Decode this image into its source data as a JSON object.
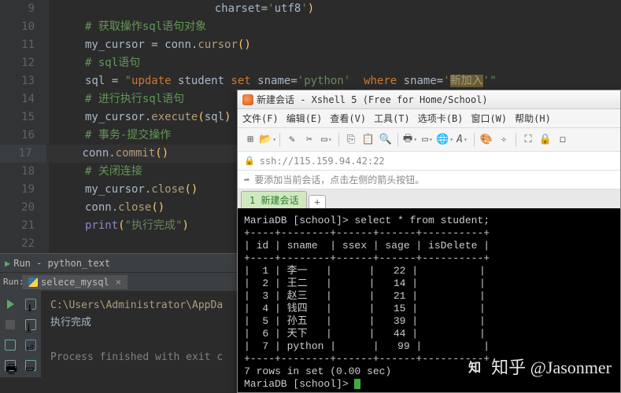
{
  "editor": {
    "lines": [
      {
        "n": "9",
        "type": "code_frag",
        "parts": [
          {
            "t": "                         charset=",
            "c": "c-var"
          },
          {
            "t": "'",
            "c": "c-str"
          },
          {
            "t": "utf8",
            "c": "c-var"
          },
          {
            "t": "'",
            "c": "c-str"
          },
          {
            "t": ")",
            "c": "c-paren"
          }
        ]
      },
      {
        "n": "10",
        "type": "comment",
        "text": "# 获取操作sql语句对象"
      },
      {
        "n": "11",
        "type": "code",
        "parts": [
          {
            "t": "my_cursor ",
            "c": "c-var"
          },
          {
            "t": "= ",
            "c": "c-op"
          },
          {
            "t": "conn",
            "c": "c-var"
          },
          {
            "t": ".",
            "c": "c-dot"
          },
          {
            "t": "cursor",
            "c": "c-fn"
          },
          {
            "t": "()",
            "c": "c-paren"
          }
        ]
      },
      {
        "n": "12",
        "type": "comment",
        "text": "# sql语句"
      },
      {
        "n": "13",
        "type": "code",
        "parts": [
          {
            "t": "sql ",
            "c": "c-var"
          },
          {
            "t": "= ",
            "c": "c-op"
          },
          {
            "t": "\"",
            "c": "c-str"
          },
          {
            "t": "update",
            "c": "sql-upd"
          },
          {
            "t": " student ",
            "c": "sql-col"
          },
          {
            "t": "set",
            "c": "sql-set"
          },
          {
            "t": " sname=",
            "c": "sql-col"
          },
          {
            "t": "'python'",
            "c": "sql-val"
          },
          {
            "t": "  ",
            "c": "sql-col"
          },
          {
            "t": "where",
            "c": "sql-where"
          },
          {
            "t": " sname=",
            "c": "sql-col"
          },
          {
            "t": "'",
            "c": "sql-val"
          },
          {
            "t": "新加入",
            "c": "sql-zh"
          },
          {
            "t": "'",
            "c": "sql-val"
          },
          {
            "t": "\"",
            "c": "c-str"
          }
        ]
      },
      {
        "n": "14",
        "type": "comment",
        "text": "# 进行执行sql语句"
      },
      {
        "n": "15",
        "type": "code",
        "parts": [
          {
            "t": "my_cursor",
            "c": "c-var"
          },
          {
            "t": ".",
            "c": "c-dot"
          },
          {
            "t": "execute",
            "c": "c-fn"
          },
          {
            "t": "(",
            "c": "c-paren"
          },
          {
            "t": "sql",
            "c": "c-var"
          },
          {
            "t": ")",
            "c": "c-paren"
          }
        ]
      },
      {
        "n": "16",
        "type": "comment",
        "text": "# 事务-提交操作"
      },
      {
        "n": "17",
        "type": "code",
        "active": true,
        "parts": [
          {
            "t": "conn",
            "c": "c-var"
          },
          {
            "t": ".",
            "c": "c-dot"
          },
          {
            "t": "commit",
            "c": "c-fn"
          },
          {
            "t": "()",
            "c": "c-paren"
          }
        ]
      },
      {
        "n": "18",
        "type": "comment",
        "text": "# 关闭连接"
      },
      {
        "n": "19",
        "type": "code",
        "parts": [
          {
            "t": "my_cursor",
            "c": "c-var"
          },
          {
            "t": ".",
            "c": "c-dot"
          },
          {
            "t": "close",
            "c": "c-fn"
          },
          {
            "t": "()",
            "c": "c-paren"
          }
        ]
      },
      {
        "n": "20",
        "type": "code",
        "parts": [
          {
            "t": "conn",
            "c": "c-var"
          },
          {
            "t": ".",
            "c": "c-dot"
          },
          {
            "t": "close",
            "c": "c-fn"
          },
          {
            "t": "()",
            "c": "c-paren"
          }
        ]
      },
      {
        "n": "21",
        "type": "code",
        "parts": [
          {
            "t": "print",
            "c": "c-print"
          },
          {
            "t": "(",
            "c": "c-paren"
          },
          {
            "t": "\"执行完成\"",
            "c": "c-str"
          },
          {
            "t": ")",
            "c": "c-paren"
          }
        ]
      },
      {
        "n": "22",
        "type": "blank"
      }
    ]
  },
  "run": {
    "header": "Run - python_text",
    "tab_label_left": "Run:",
    "tab_name": "selece_mysql",
    "output_path": "C:\\Users\\Administrator\\AppDa",
    "output_done": "执行完成",
    "output_exit": "Process finished with exit c"
  },
  "xshell": {
    "title": "新建会话 - Xshell 5 (Free for Home/School)",
    "menus": [
      "文件(F)",
      "编辑(E)",
      "查看(V)",
      "工具(T)",
      "选项卡(B)",
      "窗口(W)",
      "帮助(H)"
    ],
    "address": "ssh://115.159.94.42:22",
    "hint": "要添加当前会话，点击左侧的箭头按钮。",
    "tab": "1 新建会话",
    "tab_add": "+",
    "term_lines": [
      "MariaDB [school]> select * from student;",
      "+----+--------+------+------+----------+",
      "| id | sname  | ssex | sage | isDelete |",
      "+----+--------+------+------+----------+",
      "|  1 | 李一   |      |   22 |          |",
      "|  2 | 王二   |      |   14 |          |",
      "|  3 | 赵三   |      |   21 |          |",
      "|  4 | 钱四   |      |   15 |          |",
      "|  5 | 孙五   |      |   39 |          |",
      "|  6 | 天下   |      |   44 |          |",
      "|  7 | python |      |   99 |          |",
      "+----+--------+------+------+----------+",
      "7 rows in set (0.00 sec)",
      "",
      "MariaDB [school]> "
    ]
  },
  "watermark": "知乎 @Jasonmer"
}
